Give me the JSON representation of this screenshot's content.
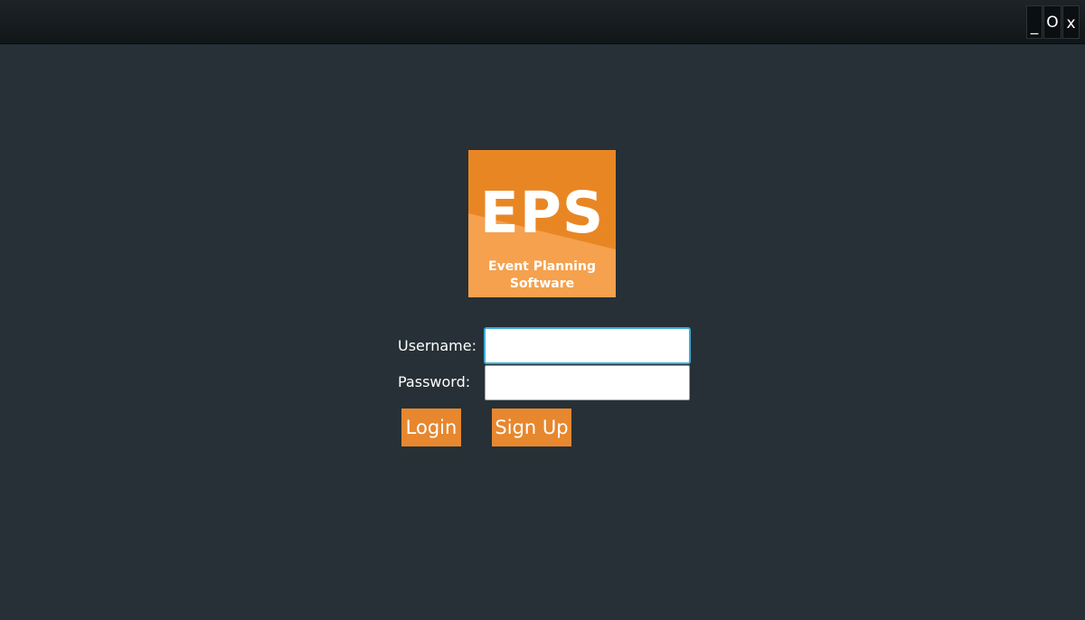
{
  "window": {
    "minimize_label": "_",
    "maximize_label": "O",
    "close_label": "x"
  },
  "logo": {
    "acronym": "EPS",
    "subtitle_line1": "Event Planning",
    "subtitle_line2": "Software",
    "primary_color": "#e98624",
    "accent_color": "#f5a14e"
  },
  "form": {
    "username_label": "Username:",
    "username_value": "",
    "password_label": "Password:",
    "password_value": ""
  },
  "actions": {
    "login_label": "Login",
    "signup_label": "Sign Up"
  },
  "theme": {
    "background": "#263036",
    "button_color": "#e7872e"
  }
}
